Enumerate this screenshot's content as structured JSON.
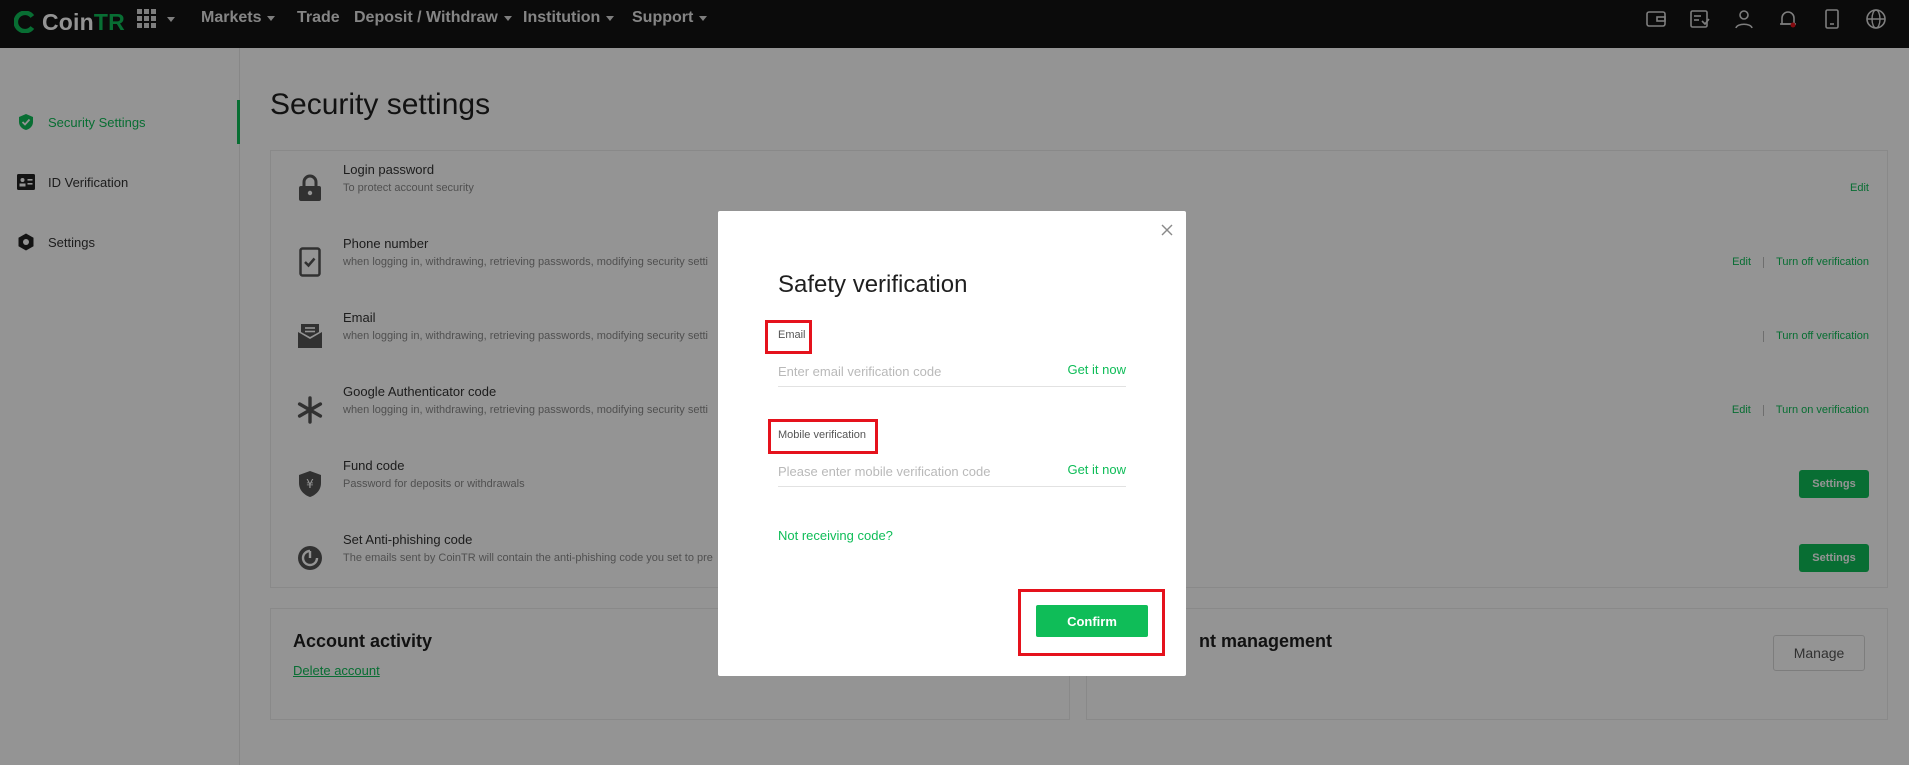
{
  "brand": {
    "name_main": "Coin",
    "name_accent": "TR",
    "accent_color": "#0fbd58"
  },
  "nav": {
    "items": [
      {
        "label": "Markets",
        "dropdown": true
      },
      {
        "label": "Trade",
        "dropdown": false
      },
      {
        "label": "Deposit / Withdraw",
        "dropdown": true
      },
      {
        "label": "Institution",
        "dropdown": true
      },
      {
        "label": "Support",
        "dropdown": true
      }
    ],
    "right_icons": [
      "wallet-icon",
      "orders-icon",
      "user-icon",
      "bell-icon",
      "download-icon",
      "globe-icon"
    ]
  },
  "sidebar": {
    "items": [
      {
        "label": "Security Settings",
        "icon": "shield-check-icon",
        "active": true
      },
      {
        "label": "ID Verification",
        "icon": "id-card-icon",
        "active": false
      },
      {
        "label": "Settings",
        "icon": "hexagon-gear-icon",
        "active": false
      }
    ]
  },
  "main": {
    "title": "Security settings",
    "rows": [
      {
        "title": "Login password",
        "desc": "To protect account security",
        "icon": "lock-icon",
        "actions": [
          "Edit"
        ]
      },
      {
        "title": "Phone number",
        "desc": "when logging in, withdrawing, retrieving passwords, modifying security setti",
        "icon": "phone-check-icon",
        "actions": [
          "Edit",
          "Turn off verification"
        ]
      },
      {
        "title": "Email",
        "desc": "when logging in, withdrawing, retrieving passwords, modifying security setti",
        "icon": "mail-icon",
        "actions": [
          "",
          "Turn off verification"
        ]
      },
      {
        "title": "Google Authenticator code",
        "desc": "when logging in, withdrawing, retrieving passwords, modifying security setti",
        "icon": "asterisk-icon",
        "actions": [
          "Edit",
          "Turn on verification"
        ]
      },
      {
        "title": "Fund code",
        "desc": "Password for deposits or withdrawals",
        "icon": "shield-yen-icon",
        "button": "Settings"
      },
      {
        "title": "Set Anti-phishing code",
        "desc": "The emails sent by CoinTR will contain the anti-phishing code you set to pre",
        "icon": "anti-phishing-icon",
        "button": "Settings"
      }
    ],
    "account_activity": {
      "title": "Account activity",
      "link": "Delete account"
    },
    "device_management": {
      "title": "nt management",
      "button": "Manage"
    }
  },
  "modal": {
    "title": "Safety verification",
    "email_label": "Email",
    "email_placeholder": "Enter email verification code",
    "email_get": "Get it now",
    "mobile_label": "Mobile verification",
    "mobile_placeholder": "Please enter mobile verification code",
    "mobile_get": "Get it now",
    "not_receiving": "Not receiving code?",
    "confirm": "Confirm"
  }
}
